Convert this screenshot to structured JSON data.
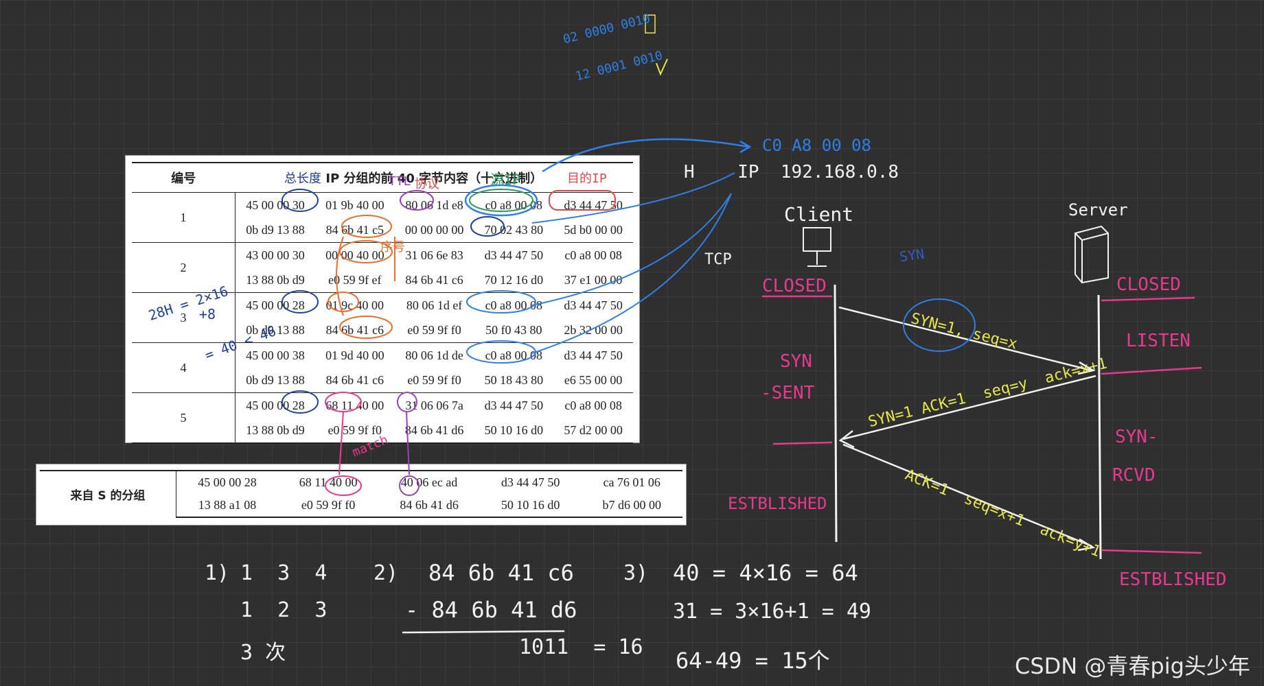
{
  "table1": {
    "headers": [
      "编号",
      "IP 分组的前 40 字节内容（十六进制）"
    ],
    "rows": [
      {
        "num": "1",
        "lines": [
          [
            "45 00 00 30",
            "01 9b 40 00",
            "80 06 1d e8",
            "c0 a8 00 08",
            "d3 44 47 50"
          ],
          [
            "0b d9 13 88",
            "84 6b 41 c5",
            "00 00 00 00",
            "70 02 43 80",
            "5d b0 00 00"
          ]
        ]
      },
      {
        "num": "2",
        "lines": [
          [
            "43 00 00 30",
            "00 00 40 00",
            "31 06 6e 83",
            "d3 44 47 50",
            "c0 a8 00 08"
          ],
          [
            "13 88 0b d9",
            "e0 59 9f ef",
            "84 6b 41 c6",
            "70 12 16 d0",
            "37 e1 00 00"
          ]
        ]
      },
      {
        "num": "3",
        "lines": [
          [
            "45 00 00 28",
            "01 9c 40 00",
            "80 06 1d ef",
            "c0 a8 00 08",
            "d3 44 47 50"
          ],
          [
            "0b d9 13 88",
            "84 6b 41 c6",
            "e0 59 9f f0",
            "50 f0 43 80",
            "2b 32 00 00"
          ]
        ]
      },
      {
        "num": "4",
        "lines": [
          [
            "45 00 00 38",
            "01 9d 40 00",
            "80 06 1d de",
            "c0 a8 00 08",
            "d3 44 47 50"
          ],
          [
            "0b d9 13 88",
            "84 6b 41 c6",
            "e0 59 9f f0",
            "50 18 43 80",
            "e6 55 00 00"
          ]
        ]
      },
      {
        "num": "5",
        "lines": [
          [
            "45 00 00 28",
            "68 11 40 00",
            "31 06 06 7a",
            "d3 44 47 50",
            "c0 a8 00 08"
          ],
          [
            "13 88 0b d9",
            "e0 59 9f f0",
            "84 6b 41 d6",
            "50 10 16 d0",
            "57 d2 00 00"
          ]
        ]
      }
    ]
  },
  "table2": {
    "label": "来自 S 的分组",
    "lines": [
      [
        "45 00 00 28",
        "68 11 40 00",
        "40 06 ec ad",
        "d3 44 47 50",
        "ca 76 01 06"
      ],
      [
        "13 88 a1 08",
        "e0 59 9f f0",
        "84 6b 41 d6",
        "50 10 16 d0",
        "b7 d6 00 00"
      ]
    ]
  },
  "annotations": {
    "top_bits": [
      "02  0000 0010",
      "12  0001 0010"
    ],
    "total_length": "总长度",
    "ttl": "TTL",
    "protocol": "协议",
    "source": "源IP",
    "dest_ip": "目的IP",
    "seq_note": "序号",
    "match": "match",
    "length_calc": [
      "28H = 2×16",
      "+8",
      "= 40 < 46"
    ],
    "hex_ip": "C0  A8  00  08",
    "ip_line": "H    IP  192.168.0.8",
    "tcp": "TCP",
    "syn_blue": "SYN"
  },
  "diagram": {
    "client": "Client",
    "server": "Server",
    "client_states": [
      "CLOSED",
      "SYN",
      "-SENT",
      "ESTBLISHED"
    ],
    "server_states": [
      "CLOSED",
      "LISTEN",
      "SYN-",
      "RCVD",
      "ESTBLISHED"
    ],
    "msg1": "SYN=1, seq=x",
    "msg2": "SYN=1 ACK=1  seq=y  ack=x+1",
    "msg3": "ACK=1  seq=x+1  ack=y+1"
  },
  "answers": {
    "a1_label": "1)",
    "a1_lines": [
      "1  3  4",
      "1  2  3",
      "3 次"
    ],
    "a2_label": "2)",
    "a2_lines": [
      "84 6b 41 c6",
      "- 84 6b 41 d6",
      "1011  = 16"
    ],
    "a3_label": "3)",
    "a3_lines": [
      "40 = 4×16 = 64",
      "31 = 3×16+1 = 49",
      "64-49 = 15个"
    ]
  },
  "watermark": "CSDN @青春pig头少年",
  "colors": {
    "background": "#2f2f2f",
    "blue": "#2f7fe6",
    "pink": "#e8398f",
    "yellow": "#e6e84a",
    "orange": "#e8702a",
    "purple": "#9a3fc0",
    "green": "#2a9a5a",
    "red": "#e24848",
    "white": "#f2f2f2"
  }
}
